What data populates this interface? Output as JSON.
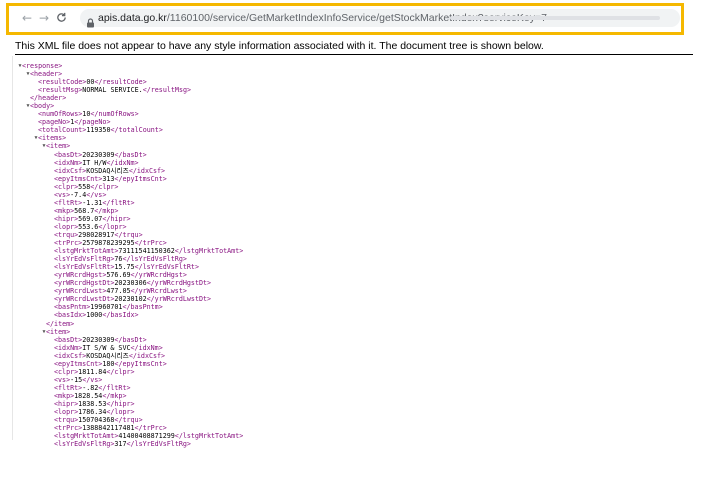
{
  "browser": {
    "url_host": "apis.data.go.kr",
    "url_path": "/1160100/service/GetMarketIndexInfoService/getStockMarketIndex?serviceKey=7",
    "back_icon": "arrow-left-icon",
    "forward_icon": "arrow-right-icon",
    "reload_icon": "reload-icon",
    "lock_icon": "lock-icon",
    "highlight_color": "#f5b800"
  },
  "info_bar": "This XML file does not appear to have any style information associated with it. The document tree is shown below.",
  "xml_lines": [
    {
      "t": "▼",
      "text": "<response>"
    },
    {
      "t": "▼",
      "text": "<header>"
    },
    {
      "text": "<resultCode>00</resultCode>"
    },
    {
      "text": "<resultMsg>NORMAL SERVICE.</resultMsg>"
    },
    {
      "text": "</header>"
    },
    {
      "t": "▼",
      "text": "<body>"
    },
    {
      "text": "<numOfRows>10</numOfRows>"
    },
    {
      "text": "<pageNo>1</pageNo>"
    },
    {
      "text": "<totalCount>119350</totalCount>"
    },
    {
      "t": "▼",
      "text": "<items>"
    },
    {
      "t": "▼",
      "text": "<item>"
    },
    {
      "text": "<basDt>20230309</basDt>"
    },
    {
      "text": "<idxNm>IT H/W</idxNm>"
    },
    {
      "text": "<idxCsf>KOSDAQ시리즈</idxCsf>"
    },
    {
      "text": "<epyItmsCnt>313</epyItmsCnt>"
    },
    {
      "text": "<clpr>558</clpr>"
    },
    {
      "text": "<vs>-7.4</vs>"
    },
    {
      "text": "<fltRt>-1.31</fltRt>"
    },
    {
      "text": "<mkp>568.7</mkp>"
    },
    {
      "text": "<hipr>569.07</hipr>"
    },
    {
      "text": "<lopr>553.6</lopr>"
    },
    {
      "text": "<trqu>298028917</trqu>"
    },
    {
      "text": "<trPrc>2579878239295</trPrc>"
    },
    {
      "text": "<lstgMrktTotAmt>73111541150362</lstgMrktTotAmt>"
    },
    {
      "text": "<lsYrEdVsFltRg>76</lsYrEdVsFltRg>"
    },
    {
      "text": "<lsYrEdVsFltRt>15.75</lsYrEdVsFltRt>"
    },
    {
      "text": "<yrWRcrdHgst>576.69</yrWRcrdHgst>"
    },
    {
      "text": "<yrWRcrdHgstDt>20230306</yrWRcrdHgstDt>"
    },
    {
      "text": "<yrWRcrdLwst>477.05</yrWRcrdLwst>"
    },
    {
      "text": "<yrWRcrdLwstDt>20230102</yrWRcrdLwstDt>"
    },
    {
      "text": "<basPntm>19960701</basPntm>"
    },
    {
      "text": "<basIdx>1000</basIdx>"
    },
    {
      "text": "</item>"
    },
    {
      "t": "▼",
      "text": "<item>"
    },
    {
      "text": "<basDt>20230309</basDt>"
    },
    {
      "text": "<idxNm>IT S/W & SVC</idxNm>"
    },
    {
      "text": "<idxCsf>KOSDAQ시리즈</idxCsf>"
    },
    {
      "text": "<epyItmsCnt>180</epyItmsCnt>"
    },
    {
      "text": "<clpr>1811.84</clpr>"
    },
    {
      "text": "<vs>-15</vs>"
    },
    {
      "text": "<fltRt>-.82</fltRt>"
    },
    {
      "text": "<mkp>1828.54</mkp>"
    },
    {
      "text": "<hipr>1838.53</hipr>"
    },
    {
      "text": "<lopr>1786.34</lopr>"
    },
    {
      "text": "<trqu>150704368</trqu>"
    },
    {
      "text": "<trPrc>1388842117481</trPrc>"
    },
    {
      "text": "<lstgMrktTotAmt>41400408871299</lstgMrktTotAmt>"
    },
    {
      "text": "<lsYrEdVsFltRg>317</lsYrEdVsFltRg>"
    }
  ]
}
